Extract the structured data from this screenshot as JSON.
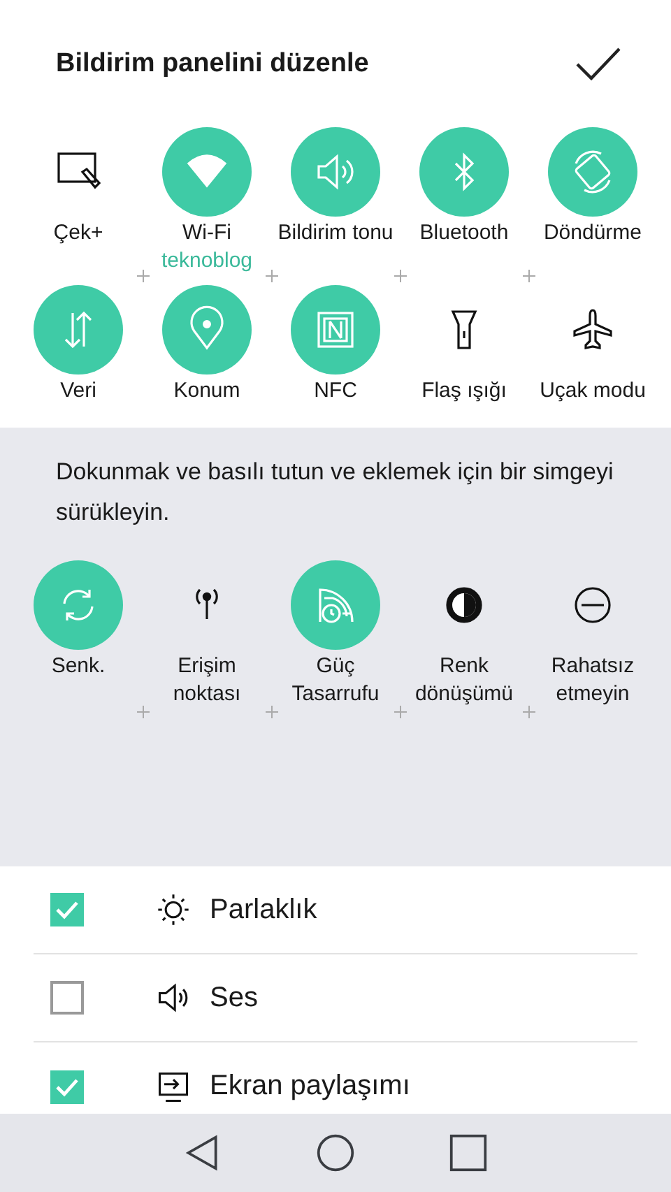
{
  "header": {
    "title": "Bildirim panelini düzenle"
  },
  "active_tiles": [
    {
      "label": "Çek+",
      "on": false
    },
    {
      "label": "Wi-Fi",
      "on": true,
      "status": "teknoblog"
    },
    {
      "label": "Bildirim tonu",
      "on": true
    },
    {
      "label": "Bluetooth",
      "on": true
    },
    {
      "label": "Döndürme",
      "on": true
    },
    {
      "label": "Veri",
      "on": true
    },
    {
      "label": "Konum",
      "on": true
    },
    {
      "label": "NFC",
      "on": true
    },
    {
      "label": "Flaş ışığı",
      "on": false
    },
    {
      "label": "Uçak modu",
      "on": false
    }
  ],
  "hint": "Dokunmak ve basılı tutun ve eklemek için bir simgeyi sürükleyin.",
  "available_tiles": [
    {
      "label": "Senk.",
      "on": true
    },
    {
      "label": "Erişim noktası",
      "on": false
    },
    {
      "label": "Güç Tasarrufu",
      "on": true
    },
    {
      "label": "Renk dönüşümü",
      "on": false
    },
    {
      "label": "Rahatsız etmeyin",
      "on": false
    }
  ],
  "options": [
    {
      "label": "Parlaklık",
      "checked": true
    },
    {
      "label": "Ses",
      "checked": false
    },
    {
      "label": "Ekran paylaşımı",
      "checked": true
    }
  ]
}
